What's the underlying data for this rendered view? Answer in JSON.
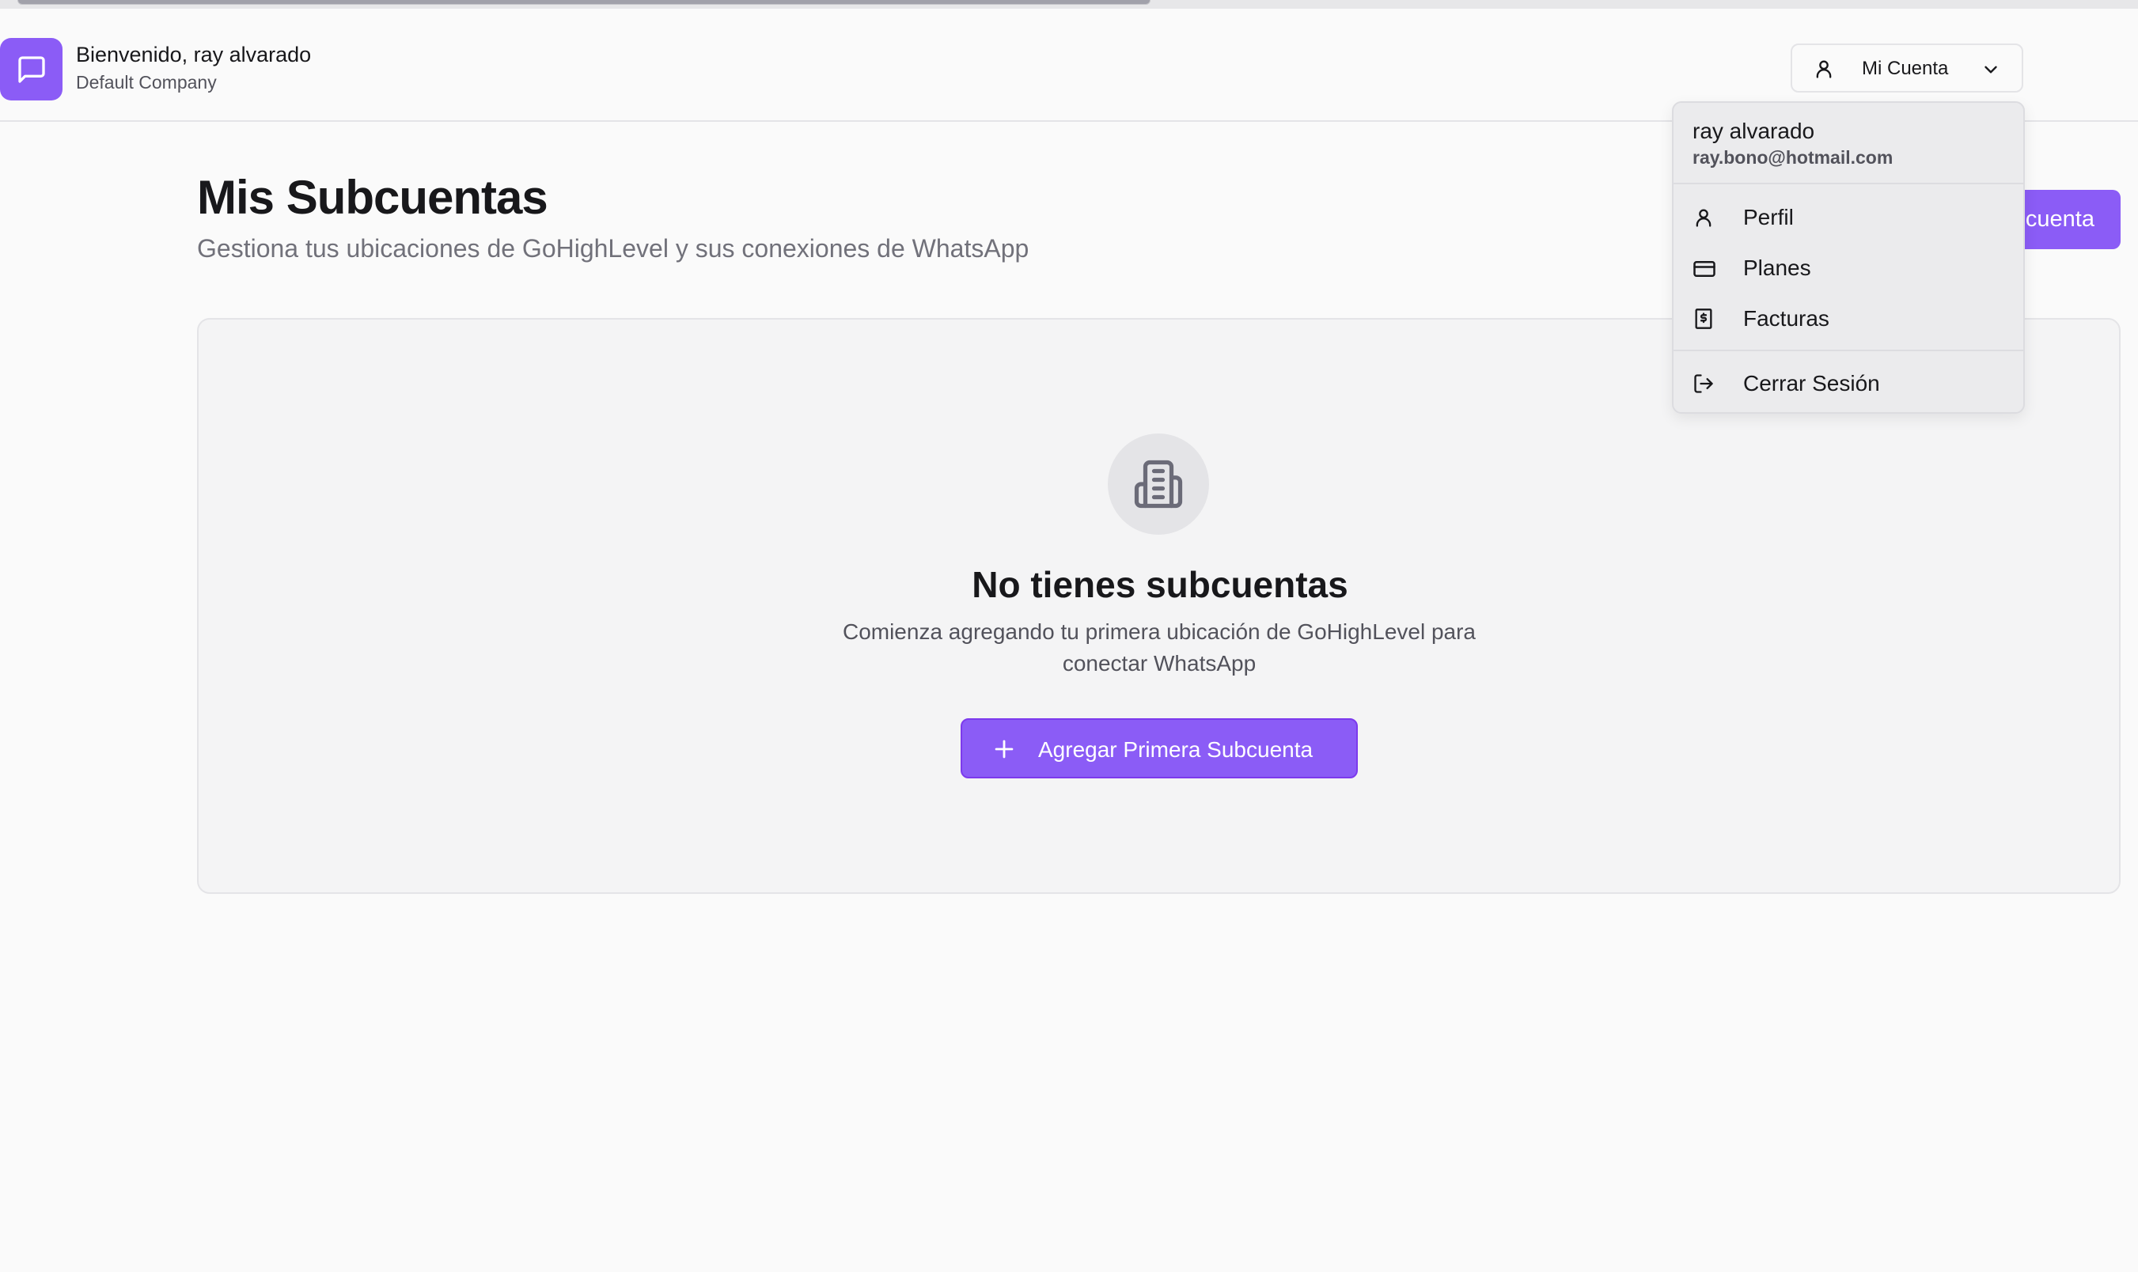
{
  "header": {
    "welcome": "Bienvenido, ray alvarado",
    "company": "Default Company",
    "account_button": "Mi Cuenta"
  },
  "page": {
    "title": "Mis Subcuentas",
    "subtitle": "Gestiona tus ubicaciones de GoHighLevel y sus conexiones de WhatsApp",
    "primary_button_visible": "cuenta"
  },
  "empty_state": {
    "title": "No tienes subcuentas",
    "description": "Comienza agregando tu primera ubicación de GoHighLevel para conectar WhatsApp",
    "button": "Agregar Primera Subcuenta"
  },
  "dropdown": {
    "name": "ray alvarado",
    "email": "ray.bono@hotmail.com",
    "items": [
      {
        "label": "Perfil",
        "icon": "user-icon"
      },
      {
        "label": "Planes",
        "icon": "credit-card-icon"
      },
      {
        "label": "Facturas",
        "icon": "receipt-icon"
      }
    ],
    "logout": {
      "label": "Cerrar Sesión",
      "icon": "logout-icon"
    }
  },
  "colors": {
    "accent": "#8b5cf6",
    "background": "#fafafa",
    "card": "#f4f4f5",
    "muted_text": "#71717a"
  }
}
